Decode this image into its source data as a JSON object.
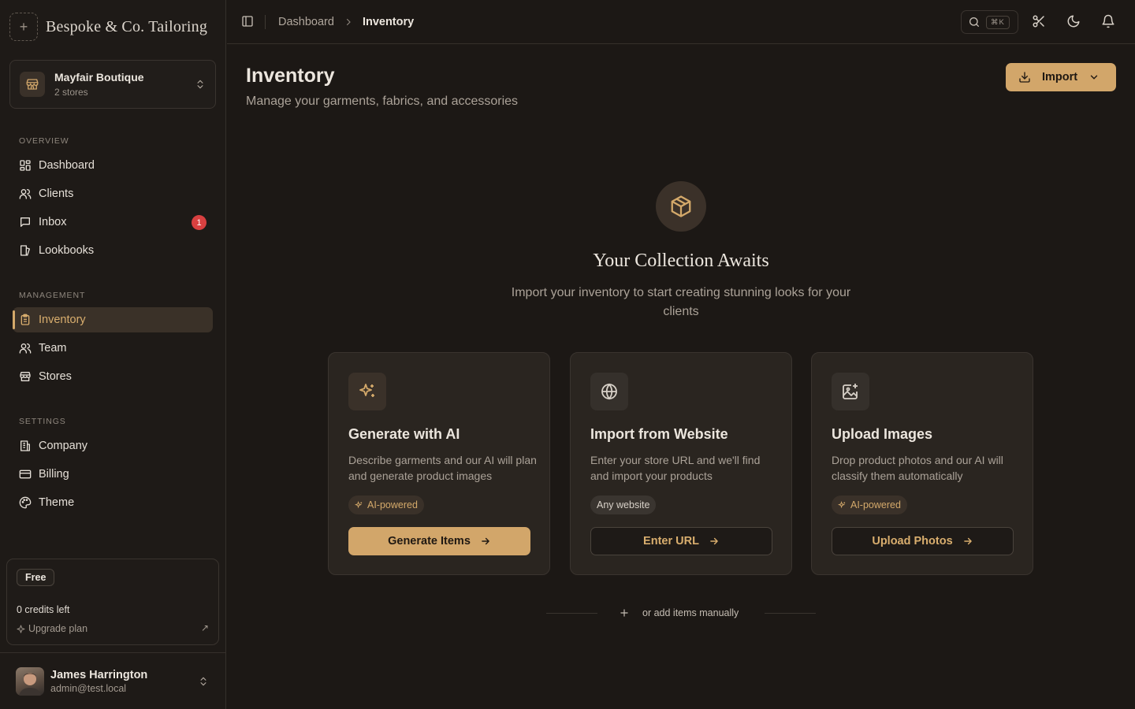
{
  "brand": {
    "name": "Bespoke & Co. Tailoring"
  },
  "store_switcher": {
    "name": "Mayfair Boutique",
    "sub": "2 stores"
  },
  "sidebar": {
    "sections": [
      {
        "label": "OVERVIEW",
        "items": [
          {
            "label": "Dashboard",
            "icon": "dashboard-icon"
          },
          {
            "label": "Clients",
            "icon": "users-icon"
          },
          {
            "label": "Inbox",
            "icon": "message-icon",
            "badge": "1"
          },
          {
            "label": "Lookbooks",
            "icon": "book-icon"
          }
        ]
      },
      {
        "label": "MANAGEMENT",
        "items": [
          {
            "label": "Inventory",
            "icon": "clipboard-icon",
            "active": true
          },
          {
            "label": "Team",
            "icon": "team-icon"
          },
          {
            "label": "Stores",
            "icon": "store-icon"
          }
        ]
      },
      {
        "label": "SETTINGS",
        "items": [
          {
            "label": "Company",
            "icon": "building-icon"
          },
          {
            "label": "Billing",
            "icon": "credit-card-icon"
          },
          {
            "label": "Theme",
            "icon": "palette-icon"
          }
        ]
      }
    ]
  },
  "plan": {
    "name": "Free",
    "credits": "0 credits left",
    "upgrade": "Upgrade plan"
  },
  "user": {
    "name": "James Harrington",
    "email": "admin@test.local"
  },
  "topbar": {
    "breadcrumb": [
      "Dashboard",
      "Inventory"
    ],
    "search_shortcut": "⌘K"
  },
  "page": {
    "title": "Inventory",
    "subtitle": "Manage your garments, fabrics, and accessories",
    "import_label": "Import"
  },
  "empty_state": {
    "title": "Your Collection Awaits",
    "description": "Import your inventory to start creating stunning looks for your clients"
  },
  "cards": [
    {
      "title": "Generate with AI",
      "description": "Describe garments and our AI will plan and generate product images",
      "tag": "AI-powered",
      "button": "Generate Items"
    },
    {
      "title": "Import from Website",
      "description": "Enter your store URL and we'll find and import your products",
      "tag": "Any website",
      "button": "Enter URL"
    },
    {
      "title": "Upload Images",
      "description": "Drop product photos and our AI will classify them automatically",
      "tag": "AI-powered",
      "button": "Upload Photos"
    }
  ],
  "manual": {
    "label": "or add items manually"
  },
  "colors": {
    "accent": "#d2a66a",
    "background": "#1c1815",
    "badge": "#d84040"
  }
}
